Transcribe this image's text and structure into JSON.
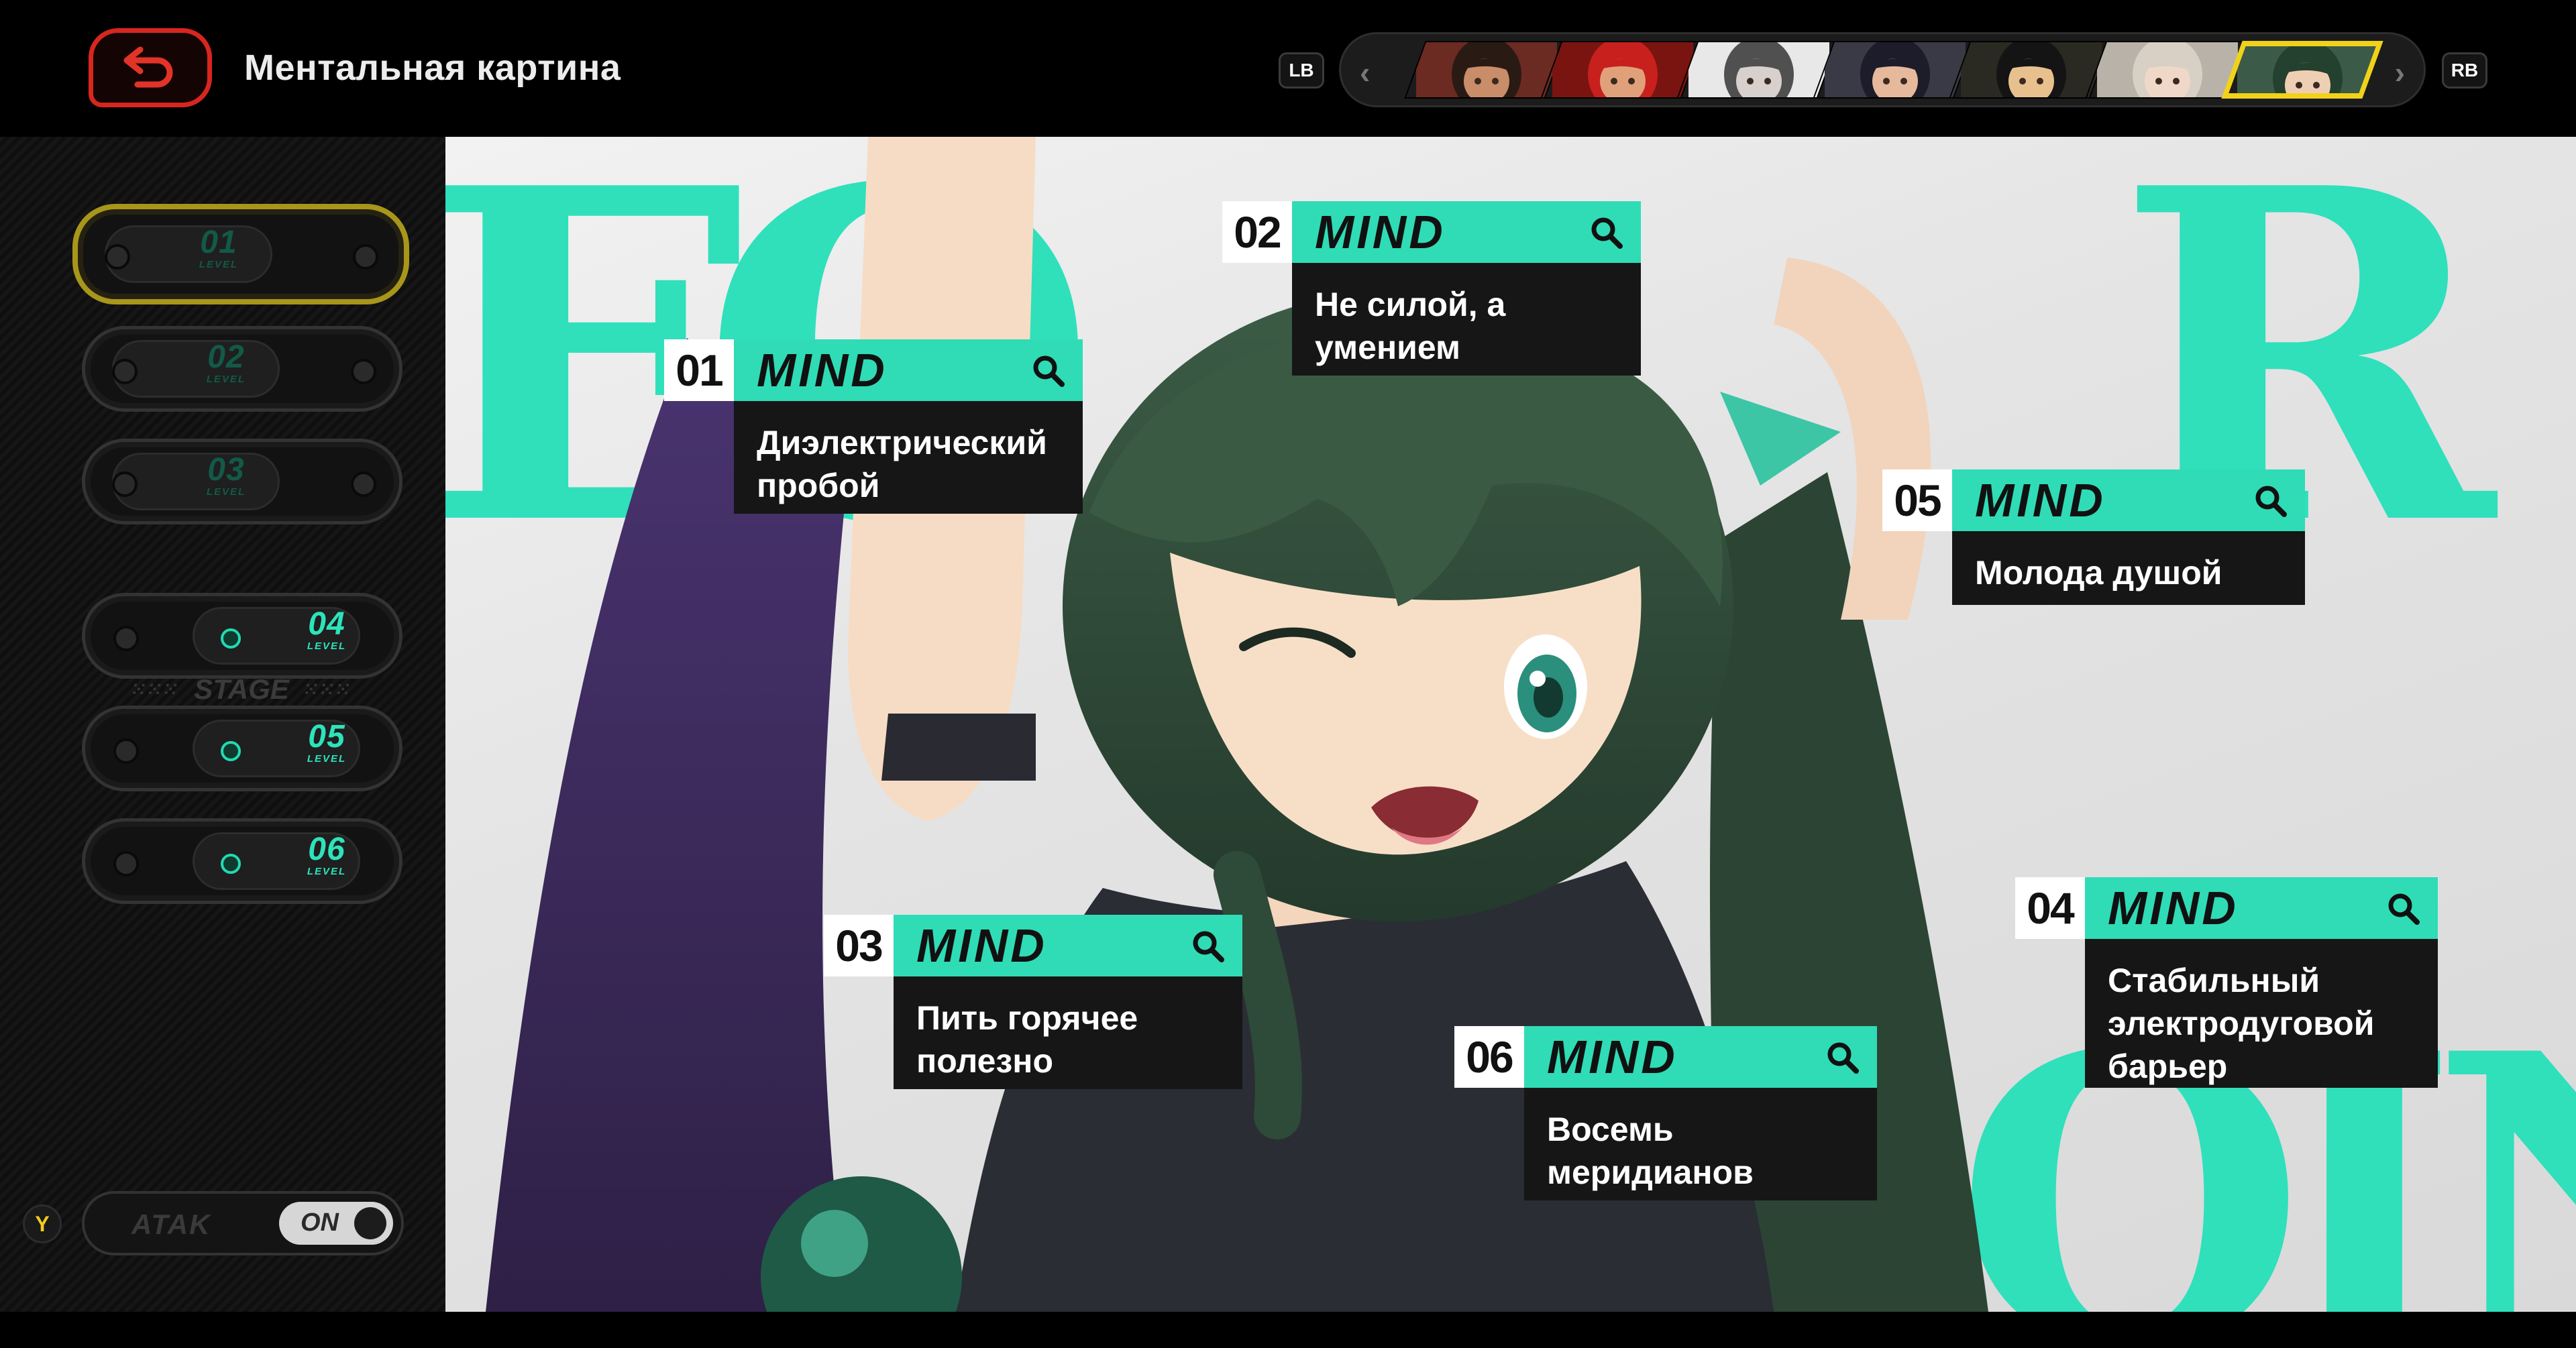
{
  "header": {
    "title": "Ментальная картина",
    "lb_label": "LB",
    "rb_label": "RB"
  },
  "characters": [
    {
      "name": "portrait-1",
      "skin": "#c98d6a",
      "hair": "#2a1a14",
      "bg": "#6b2a22"
    },
    {
      "name": "portrait-2",
      "skin": "#e0a07a",
      "hair": "#c8201c",
      "bg": "#7a1410"
    },
    {
      "name": "portrait-3",
      "skin": "#d8d0cc",
      "hair": "#505050",
      "bg": "#e8e8e8"
    },
    {
      "name": "portrait-4",
      "skin": "#e6b89c",
      "hair": "#1c1c2a",
      "bg": "#3a3a46"
    },
    {
      "name": "portrait-5",
      "skin": "#e8c08e",
      "hair": "#141414",
      "bg": "#2a2a22"
    },
    {
      "name": "portrait-6",
      "skin": "#f0d8c8",
      "hair": "#d8d0c4",
      "bg": "#b8b2a8"
    },
    {
      "name": "portrait-7",
      "skin": "#efcfb4",
      "hair": "#24402e",
      "bg": "#3c5a48",
      "selected": true
    }
  ],
  "levels": [
    {
      "num": "01",
      "sub": "LEVEL",
      "active": true,
      "unlocked": false
    },
    {
      "num": "02",
      "sub": "LEVEL",
      "active": false,
      "unlocked": false
    },
    {
      "num": "03",
      "sub": "LEVEL",
      "active": false,
      "unlocked": false
    },
    {
      "num": "04",
      "sub": "LEVEL",
      "active": false,
      "unlocked": true
    },
    {
      "num": "05",
      "sub": "LEVEL",
      "active": false,
      "unlocked": true
    },
    {
      "num": "06",
      "sub": "LEVEL",
      "active": false,
      "unlocked": true
    }
  ],
  "stage_label": "STAGE",
  "toggle": {
    "button": "Y",
    "label": "ATAK",
    "state": "ON"
  },
  "backdrop_letters": [
    "E",
    "Q",
    "R",
    "Q",
    "I",
    "N"
  ],
  "mind_cards": [
    {
      "num": "01",
      "header": "MIND",
      "title": "Диэлектрический пробой"
    },
    {
      "num": "02",
      "header": "MIND",
      "title": "Не силой, а умением"
    },
    {
      "num": "03",
      "header": "MIND",
      "title": "Пить горячее полезно"
    },
    {
      "num": "04",
      "header": "MIND",
      "title": "Стабильный электродуговой барьер"
    },
    {
      "num": "05",
      "header": "MIND",
      "title": "Молода душой"
    },
    {
      "num": "06",
      "header": "MIND",
      "title": "Восемь меридианов"
    }
  ],
  "colors": {
    "accent": "#2fdcb6",
    "selected": "#f1d21a",
    "back": "#d8261f",
    "card_bg": "#161616"
  }
}
